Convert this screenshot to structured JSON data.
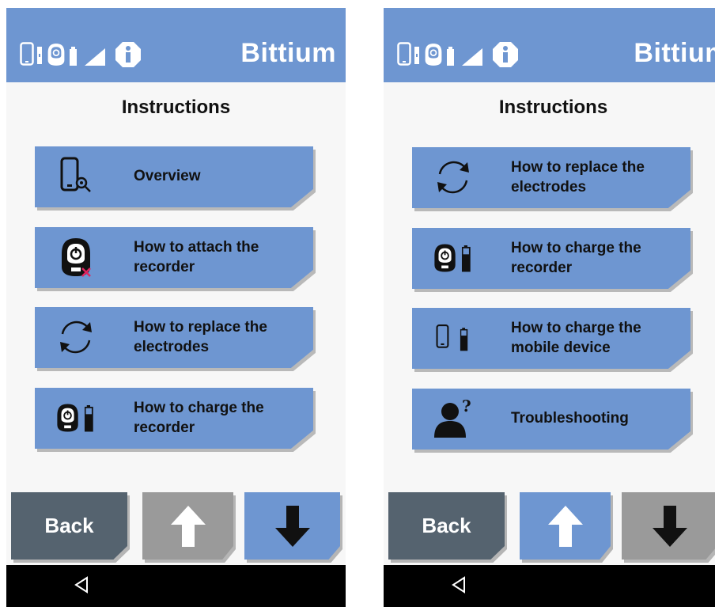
{
  "brand": "Bittium",
  "colors": {
    "accent": "#6e96d1",
    "back": "#55636f",
    "disabled": "#9a9a9a",
    "navbar": "#000000"
  },
  "screens": [
    {
      "title": "Instructions",
      "items": [
        {
          "icon": "phone-search-icon",
          "label": "Overview"
        },
        {
          "icon": "recorder-attach-icon",
          "label": "How to attach the recorder"
        },
        {
          "icon": "refresh-icon",
          "label": "How to replace the electrodes"
        },
        {
          "icon": "recorder-battery-icon",
          "label": "How to charge the recorder"
        }
      ],
      "nav": {
        "back_label": "Back",
        "up_enabled": false,
        "down_enabled": true
      }
    },
    {
      "title": "Instructions",
      "items": [
        {
          "icon": "refresh-icon",
          "label": "How to replace the electrodes"
        },
        {
          "icon": "recorder-battery-icon",
          "label": "How to charge the recorder"
        },
        {
          "icon": "phone-battery-icon",
          "label": "How to charge the mobile device"
        },
        {
          "icon": "person-question-icon",
          "label": "Troubleshooting"
        }
      ],
      "nav": {
        "back_label": "Back",
        "up_enabled": true,
        "down_enabled": false
      }
    }
  ]
}
